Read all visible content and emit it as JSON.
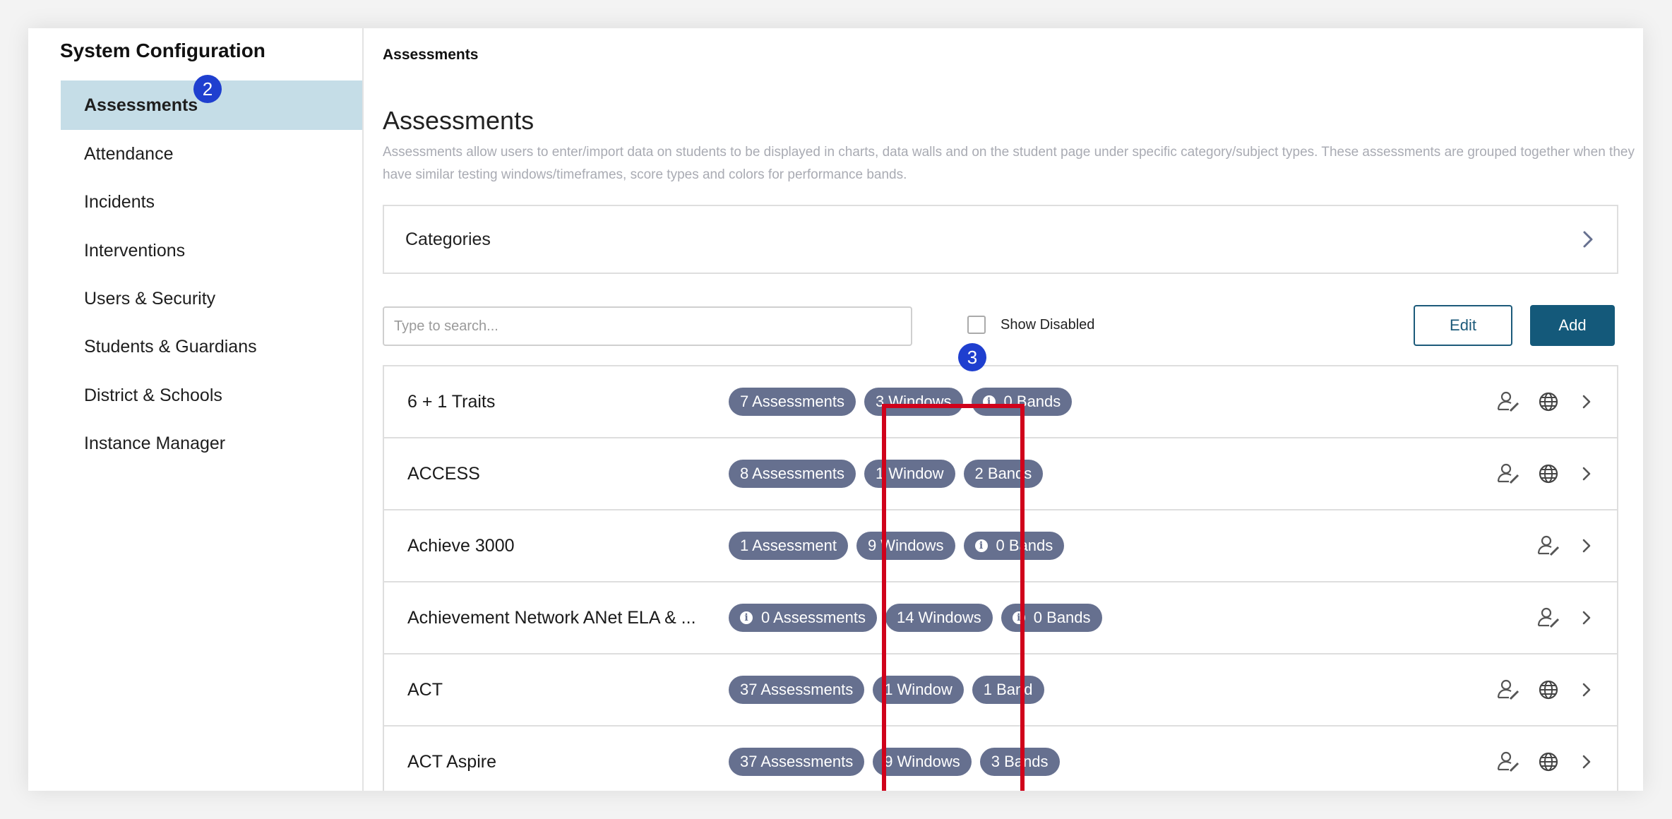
{
  "sidebar": {
    "title": "System Configuration",
    "items": [
      {
        "label": "Assessments",
        "active": true
      },
      {
        "label": "Attendance"
      },
      {
        "label": "Incidents"
      },
      {
        "label": "Interventions"
      },
      {
        "label": "Users & Security"
      },
      {
        "label": "Students & Guardians"
      },
      {
        "label": "District & Schools"
      },
      {
        "label": "Instance Manager"
      }
    ]
  },
  "markers": {
    "step2": "2",
    "step3": "3"
  },
  "main": {
    "breadcrumb": "Assessments",
    "title": "Assessments",
    "description": "Assessments allow users to enter/import data on students to be displayed in charts, data walls and on the student page under specific category/subject types. These assessments are grouped together when they have similar testing windows/timeframes, score types and colors for performance bands.",
    "categories_label": "Categories",
    "search_placeholder": "Type to search...",
    "show_disabled_label": "Show Disabled",
    "edit_label": "Edit",
    "add_label": "Add"
  },
  "rows": [
    {
      "name": "6 + 1 Traits",
      "assessments": "7 Assessments",
      "windows": "3 Windows",
      "bands": "0 Bands",
      "globe": true
    },
    {
      "name": "ACCESS",
      "assessments": "8 Assessments",
      "windows": "1 Window",
      "bands": "2 Bands",
      "globe": true
    },
    {
      "name": "Achieve 3000",
      "assessments": "1 Assessment",
      "windows": "9 Windows",
      "bands": "0 Bands",
      "globe": false
    },
    {
      "name": "Achievement Network ANet ELA & ...",
      "assessments": "0 Assessments",
      "windows": "14 Windows",
      "bands": "0 Bands",
      "globe": false
    },
    {
      "name": "ACT",
      "assessments": "37 Assessments",
      "windows": "1 Window",
      "bands": "1 Band",
      "globe": true
    },
    {
      "name": "ACT Aspire",
      "assessments": "37 Assessments",
      "windows": "9 Windows",
      "bands": "3 Bands",
      "globe": true
    }
  ],
  "colors": {
    "accent": "#14597a",
    "chip": "#66708f",
    "active_nav": "#c5dde7",
    "marker": "#1f3fcf",
    "highlight": "#d0021b"
  }
}
